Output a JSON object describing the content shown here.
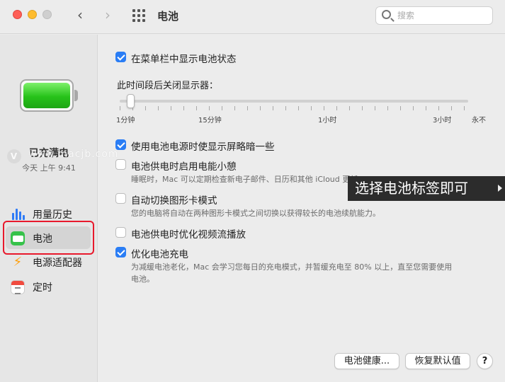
{
  "window": {
    "title": "电池",
    "nav_back": "‹",
    "nav_forward": "›"
  },
  "search": {
    "placeholder": "搜索"
  },
  "sidebar": {
    "status": "已充满电",
    "time": "今天 上午 9:41",
    "items": [
      {
        "label": "用量历史",
        "icon": "usage-history-icon"
      },
      {
        "label": "电池",
        "icon": "battery-icon",
        "active": true
      },
      {
        "label": "电源适配器",
        "icon": "power-adapter-icon"
      },
      {
        "label": "定时",
        "icon": "schedule-icon"
      }
    ]
  },
  "watermark": {
    "text": "www.macjb.com"
  },
  "settings": {
    "show_in_menubar": {
      "label": "在菜单栏中显示电池状态",
      "checked": true
    },
    "display_off_label": "此时间段后关闭显示器：",
    "slider": {
      "ticks": [
        "1分钟",
        "15分钟",
        "1小时",
        "3小时",
        "永不"
      ],
      "value": "1分钟"
    },
    "dim_on_battery": {
      "label": "使用电池电源时使显示屏略暗一些",
      "checked": true
    },
    "power_nap": {
      "label": "电池供电时启用电能小憩",
      "checked": false,
      "desc": "睡眠时，Mac 可以定期检查新电子邮件、日历和其他 iCloud 更新"
    },
    "auto_graphics": {
      "label": "自动切换图形卡模式",
      "checked": false,
      "desc": "您的电脑将自动在两种图形卡模式之间切换以获得较长的电池续航能力。"
    },
    "video_streaming": {
      "label": "电池供电时优化视频流播放",
      "checked": false
    },
    "optimized_charging": {
      "label": "优化电池充电",
      "checked": true,
      "desc_line1": "为减缓电池老化，Mac 会学习您每日的充电模式，并暂缓充电至 80% 以上，直至您需要使用",
      "desc_line2": "电池。"
    }
  },
  "tooltip": {
    "text": "选择电池标签即可"
  },
  "buttons": {
    "health": "电池健康...",
    "restore": "恢复默认值",
    "help": "?"
  },
  "colors": {
    "accent": "#2a7df5",
    "highlight": "#e8192c",
    "battery_green": "#27c21a"
  }
}
